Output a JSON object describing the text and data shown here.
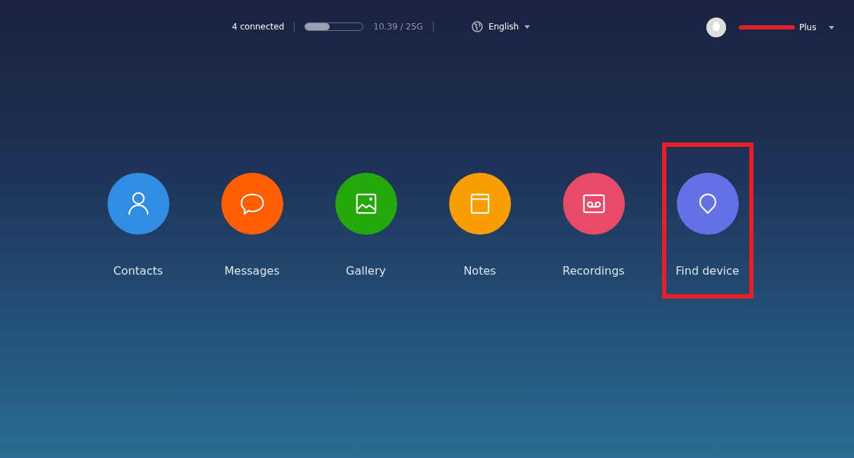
{
  "top_bar": {
    "connected": "4 connected",
    "storage": {
      "level": 0.42,
      "reading": "10.39 / 25G"
    },
    "language": "English",
    "account": {
      "name": "Plus",
      "redacted": true
    }
  },
  "apps": [
    {
      "label": "Contacts",
      "kind": "contacts",
      "color": "#318de2",
      "highlighted": false
    },
    {
      "label": "Messages",
      "kind": "messages",
      "color": "#ff5f00",
      "highlighted": false
    },
    {
      "label": "Gallery",
      "kind": "gallery",
      "color": "#25a90a",
      "highlighted": false
    },
    {
      "label": "Notes",
      "kind": "notes",
      "color": "#f99e00",
      "highlighted": false
    },
    {
      "label": "Recordings",
      "kind": "recordings",
      "color": "#e94a68",
      "highlighted": false
    },
    {
      "label": "Find device",
      "kind": "find",
      "color": "#6470e6",
      "highlighted": true
    }
  ]
}
